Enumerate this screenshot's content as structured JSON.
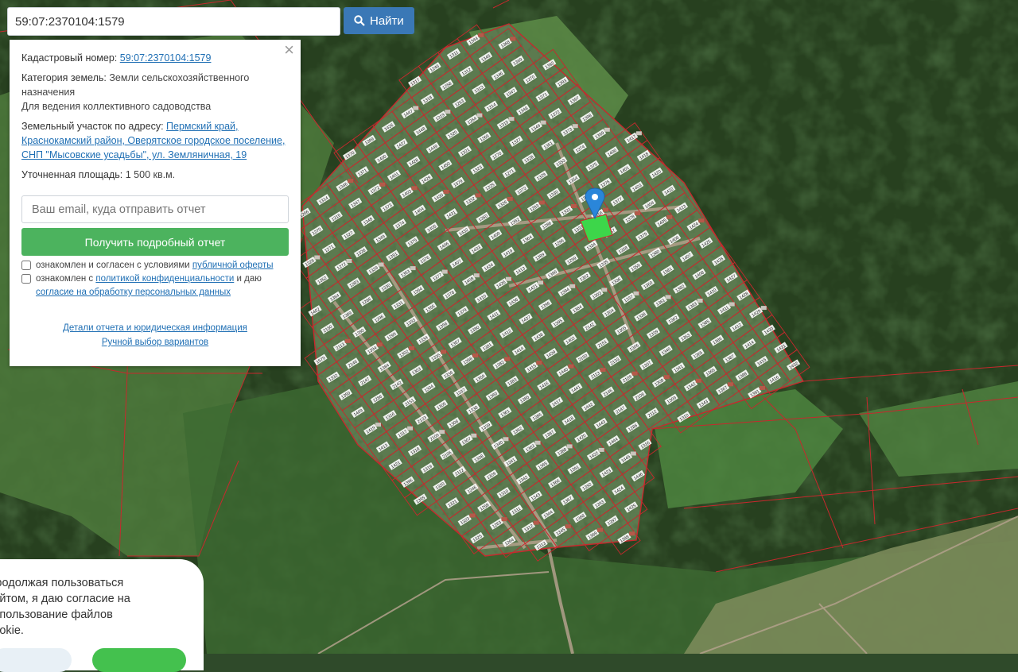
{
  "search": {
    "value": "59:07:2370104:1579",
    "button_label": "Найти"
  },
  "panel": {
    "cadastral_label": "Кадастровый номер:",
    "cadastral_value": "59:07:2370104:1579",
    "category_label": "Категория земель:",
    "category_value": "Земли сельскохозяйственного назначения",
    "purpose": "Для ведения коллективного садоводства",
    "address_label": "Земельный участок по адресу:",
    "address_value": "Пермский край, Краснокамский район, Оверятское городское поселение, СНП \"Мысовские усадьбы\", ул. Земляничная, 19",
    "area_label": "Уточненная площадь:",
    "area_value": "1 500 кв.м.",
    "email_placeholder": "Ваш email, куда отправить отчет",
    "report_button": "Получить подробный отчет",
    "consent1_prefix": "ознакомлен и согласен с условиями",
    "consent1_link": "публичной оферты",
    "consent2_prefix": "ознакомлен с",
    "consent2_link": "политикой конфиденциальности",
    "consent2_mid": "и даю",
    "consent2_link2": "согласие на обработку персональных данных",
    "details_link": "Детали отчета и юридическая информация",
    "manual_link": "Ручной выбор вариантов"
  },
  "cookie": {
    "text": "Продолжая пользоваться сайтом, я даю согласие на использование файлов cookie."
  },
  "map": {
    "forest_color": "#27401f",
    "field_color": "#4b7a3a",
    "settlement_color": "#5d7a52",
    "parcel_line_color": "#c8282d",
    "selected_parcel_color": "#3dd64a",
    "marker_color": "#2a86d9",
    "road_color": "#b9a895",
    "parcel_labels": [
      "1579",
      "1332",
      "1350",
      "1409",
      "1419",
      "1413",
      "1421",
      "1396",
      "1395",
      "1402",
      "2150",
      "2113",
      "2146",
      "2147",
      "1286",
      "1316",
      "1317",
      "1318",
      "1319",
      "1320",
      "1321",
      "1323",
      "1325",
      "1326",
      "1352",
      "1364",
      "1389",
      "1390",
      "1394",
      "1384",
      "2142",
      "2151",
      "2133",
      "2109",
      "2106",
      "2112",
      "1246",
      "1258",
      "1263",
      "1264",
      "1266",
      "1270",
      "1271",
      "1272",
      "1283",
      "1286",
      "1296",
      "1299",
      "1302",
      "1303",
      "1304",
      "1305",
      "1306",
      "1307",
      "1308",
      "1309",
      "1310",
      "1311",
      "1312",
      "1313",
      "1314",
      "1315",
      "1327",
      "1328",
      "1329",
      "1330",
      "1331",
      "1333",
      "1334",
      "1335",
      "1336",
      "1337",
      "1338",
      "1339",
      "1340",
      "1341",
      "1342",
      "1343",
      "1344",
      "1345",
      "1346",
      "1347",
      "1348",
      "1349",
      "1351",
      "1353",
      "1354",
      "1355",
      "1356",
      "1357",
      "1358",
      "1359",
      "1360",
      "1361",
      "1362",
      "1363",
      "1365",
      "1366",
      "1367",
      "1368",
      "1369",
      "1370",
      "1371",
      "1372",
      "1373",
      "1374",
      "1375",
      "1376",
      "1377",
      "1378",
      "1379",
      "1380",
      "1381",
      "1382",
      "1383",
      "1385",
      "1386",
      "1387",
      "1388",
      "1391",
      "1392",
      "1393",
      "1397",
      "1398",
      "1399",
      "1400",
      "1401",
      "1403",
      "1404",
      "1405",
      "1406",
      "1407",
      "1408",
      "1410",
      "1411",
      "1412",
      "1414",
      "1415",
      "1416",
      "1417",
      "1418",
      "1420",
      "1422",
      "1423",
      "1424",
      "1425",
      "1426",
      "1427",
      "1428",
      "1429",
      "1430",
      "1431",
      "1432",
      "1433",
      "1434",
      "1435",
      "1436",
      "1437",
      "1438",
      "1439",
      "1440",
      "1441",
      "1442",
      "1443",
      "1444",
      "1445",
      "1446",
      "1447",
      "1448",
      "1449",
      "1450"
    ]
  }
}
